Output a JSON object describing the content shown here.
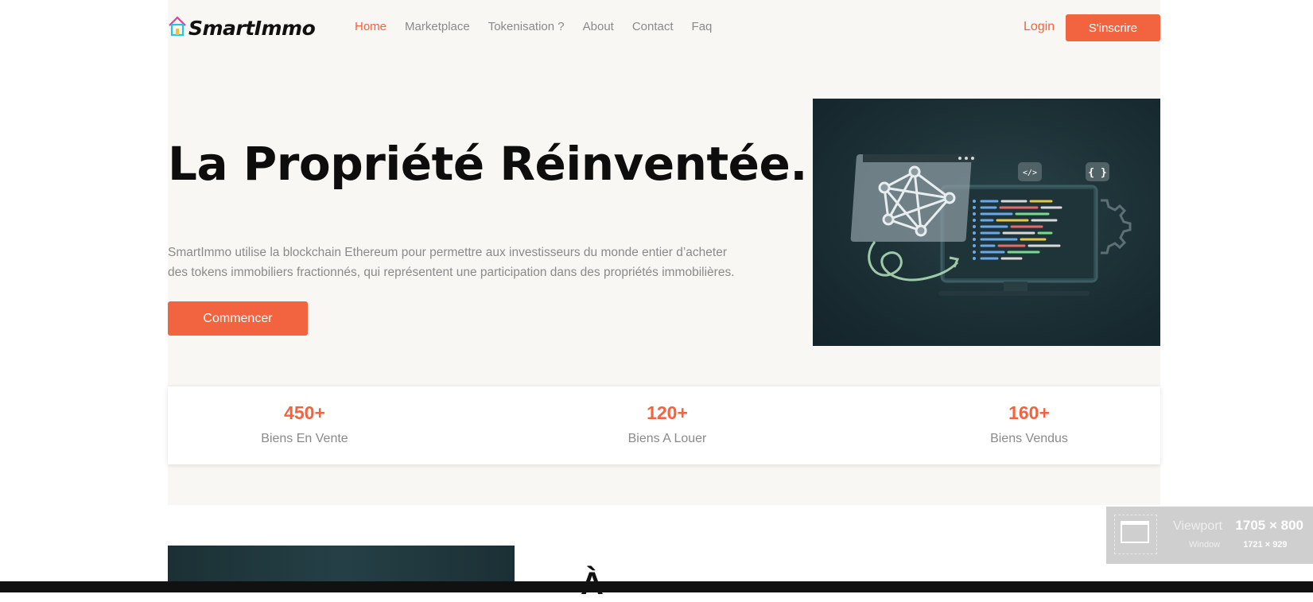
{
  "brand": {
    "name": "SmartImmo"
  },
  "nav": {
    "links": [
      "Home",
      "Marketplace",
      "Tokenisation ?",
      "About",
      "Contact",
      "Faq"
    ],
    "active": "Home",
    "login": "Login",
    "signup": "S'inscrire"
  },
  "hero": {
    "title": "La Propriété Réinventée.",
    "description": "SmartImmo utilise la blockchain Ethereum pour permettre aux investisseurs du monde entier d’acheter des tokens immobiliers fractionnés, qui représentent une participation dans des propriétés immobilières.",
    "cta": "Commencer"
  },
  "stats": [
    {
      "value": "450+",
      "label": "Biens En Vente"
    },
    {
      "value": "120+",
      "label": "Biens A Louer"
    },
    {
      "value": "160+",
      "label": "Biens Vendus"
    }
  ],
  "lower": {
    "heading_fragment": "À"
  },
  "viewport_badge": {
    "viewport_label": "Viewport",
    "viewport_value": "1705 × 800",
    "window_label": "Window",
    "window_value": "1721 × 929"
  },
  "colors": {
    "accent": "#f26440",
    "background": "#f8f7f4",
    "text_muted": "#8a8a8a"
  },
  "icons": [
    "house-logo-icon",
    "hero-blockchain-illustration",
    "viewport-window-icon"
  ]
}
